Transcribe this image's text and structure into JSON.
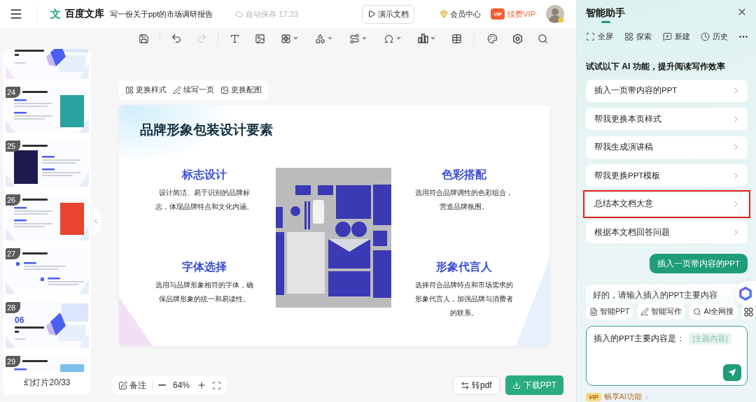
{
  "top_bar": {
    "logo_mark": "文",
    "brand": "百度文库",
    "document_title": "写一份关于ppt的市场调研报告",
    "autosave": "自动保存 17:23",
    "present_button": "演示文档",
    "member_center": "会员中心",
    "vip_badge": "VIP",
    "renew_vip": "续费VIP"
  },
  "toolbar": {
    "undo": {
      "disabled": false
    },
    "redo": {
      "disabled": true
    }
  },
  "thumbnails": {
    "items": [
      {
        "kind": "chapter"
      },
      {
        "number": "24",
        "kind": "image-right",
        "color": "#2aa3a0"
      },
      {
        "number": "25",
        "kind": "image-left",
        "color": "#1d1b4f"
      },
      {
        "number": "26",
        "kind": "image-right",
        "color": "#e8442f"
      },
      {
        "number": "27",
        "kind": "text-only"
      },
      {
        "number": "28",
        "kind": "chapter",
        "chapter_number": "06"
      },
      {
        "number": "29",
        "kind": "image-right",
        "color": "#7cc0ec"
      }
    ],
    "counter": "幻灯片20/33"
  },
  "slide_toolbar": [
    {
      "label": "更换样式",
      "kind": "style"
    },
    {
      "label": "续写一页",
      "kind": "continue"
    },
    {
      "label": "更换配图",
      "kind": "image"
    }
  ],
  "slide": {
    "title": "品牌形象包装设计要素",
    "sections": [
      {
        "heading": "标志设计",
        "text": "设计简洁、易于识别的品牌标志，体现品牌特点和文化内涵。"
      },
      {
        "heading": "色彩搭配",
        "text": "选用符合品牌调性的色彩组合，营造品牌氛围。"
      },
      {
        "heading": "字体选择",
        "text": "选用与品牌形象相符的字体，确保品牌形象的统一和易读性。"
      },
      {
        "heading": "形象代言人",
        "text": "选择符合品牌特点和市场需求的形象代言人，加强品牌与消费者的联系。"
      }
    ]
  },
  "bottom_bar": {
    "notes": "备注",
    "zoom": "64%",
    "convert_pdf": "转pdf",
    "download": "下载PPT"
  },
  "assistant": {
    "title": "智能助手",
    "actions": [
      {
        "label": "全屏",
        "kind": "fullscreen"
      },
      {
        "label": "探索",
        "kind": "explore"
      },
      {
        "label": "新建",
        "kind": "new"
      },
      {
        "label": "历史",
        "kind": "history"
      }
    ],
    "heading": "试试以下 AI 功能，提升阅读写作效率",
    "suggestions": [
      {
        "label": "插入一页带内容的PPT",
        "highlighted": false
      },
      {
        "label": "帮我更换本页样式",
        "highlighted": false
      },
      {
        "label": "帮我生成演讲稿",
        "highlighted": false
      },
      {
        "label": "帮我更换PPT模板",
        "highlighted": false
      },
      {
        "label": "总结本文档大意",
        "highlighted": true
      },
      {
        "label": "根据本文档回答问题",
        "highlighted": false
      }
    ],
    "user_message": "插入一页带内容的PPT",
    "reply": "好的，请输入插入的PPT主要内容",
    "tools": [
      {
        "label": "智能PPT",
        "kind": "ppt"
      },
      {
        "label": "智能写作",
        "kind": "write"
      },
      {
        "label": "AI全网搜",
        "kind": "search"
      }
    ],
    "input": {
      "value": "插入的PPT主要内容是：",
      "slot": "[主题内容]"
    },
    "footer": {
      "badge": "VIP",
      "text": "畅享AI功能"
    }
  }
}
